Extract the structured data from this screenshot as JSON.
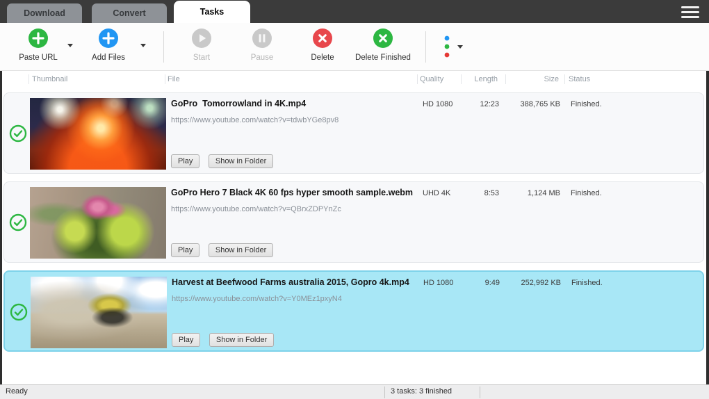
{
  "tabs": [
    {
      "label": "Download",
      "active": false
    },
    {
      "label": "Convert",
      "active": false
    },
    {
      "label": "Tasks",
      "active": true
    }
  ],
  "menu": {
    "icon": "hamburger-icon"
  },
  "toolbar": {
    "buttons": [
      {
        "label": "Paste URL",
        "icon": "plus-circle-icon",
        "color": "#2db742",
        "enabled": true,
        "dropdown": true
      },
      {
        "label": "Add Files",
        "icon": "plus-circle-icon",
        "color": "#2196f3",
        "enabled": true,
        "dropdown": true
      },
      {
        "label": "Start",
        "icon": "play-circle-icon",
        "color": "#c9c9c9",
        "enabled": false,
        "dropdown": false
      },
      {
        "label": "Pause",
        "icon": "pause-circle-icon",
        "color": "#c9c9c9",
        "enabled": false,
        "dropdown": false
      },
      {
        "label": "Delete",
        "icon": "x-circle-icon",
        "color": "#e8474c",
        "enabled": true,
        "dropdown": false
      },
      {
        "label": "Delete Finished",
        "icon": "x-circle-icon",
        "color": "#2db742",
        "enabled": true,
        "dropdown": false
      }
    ],
    "overflow_icon": "three-dots-icon",
    "dropdown_icon": "caret-down-icon"
  },
  "table": {
    "columns": [
      "Thumbnail",
      "File",
      "Quality",
      "Length",
      "Size",
      "Status"
    ],
    "rows": [
      {
        "title": "GoPro  Tomorrowland in 4K.mp4",
        "url": "https://www.youtube.com/watch?v=tdwbYGe8pv8",
        "quality": "HD 1080",
        "length": "12:23",
        "size": "388,765 KB",
        "status": "Finished.",
        "thumbnail": "fireworks bursting over festival crowd at night",
        "status_icon": "check-circle-icon",
        "selected": false
      },
      {
        "title": "GoPro Hero 7 Black 4K 60 fps hyper smooth sample.webm",
        "url": "https://www.youtube.com/watch?v=QBrxZDPYnZc",
        "quality": "UHD 4K",
        "length": "8:53",
        "size": "1,124 MB",
        "status": "Finished.",
        "thumbnail": "flower basket with pink blooms on brick street",
        "status_icon": "check-circle-icon",
        "selected": false
      },
      {
        "title": "Harvest at Beefwood Farms australia 2015, Gopro 4k.mp4",
        "url": "https://www.youtube.com/watch?v=Y0MEz1pxyN4",
        "quality": "HD 1080",
        "length": "9:49",
        "size": "252,992 KB",
        "status": "Finished.",
        "thumbnail": "tractor harvesting in dusty field under blue sky",
        "status_icon": "check-circle-icon",
        "selected": true
      }
    ]
  },
  "row_actions": [
    "Play",
    "Show in Folder"
  ],
  "statusbar": {
    "left": "Ready",
    "right": "3 tasks: 3 finished"
  },
  "colors": {
    "accent_green": "#2db742",
    "accent_blue": "#2196f3",
    "accent_red": "#e8474c",
    "selection": "#a8e7f6",
    "titlebar": "#3b3b3b",
    "inactive_tab": "#8e9297"
  }
}
